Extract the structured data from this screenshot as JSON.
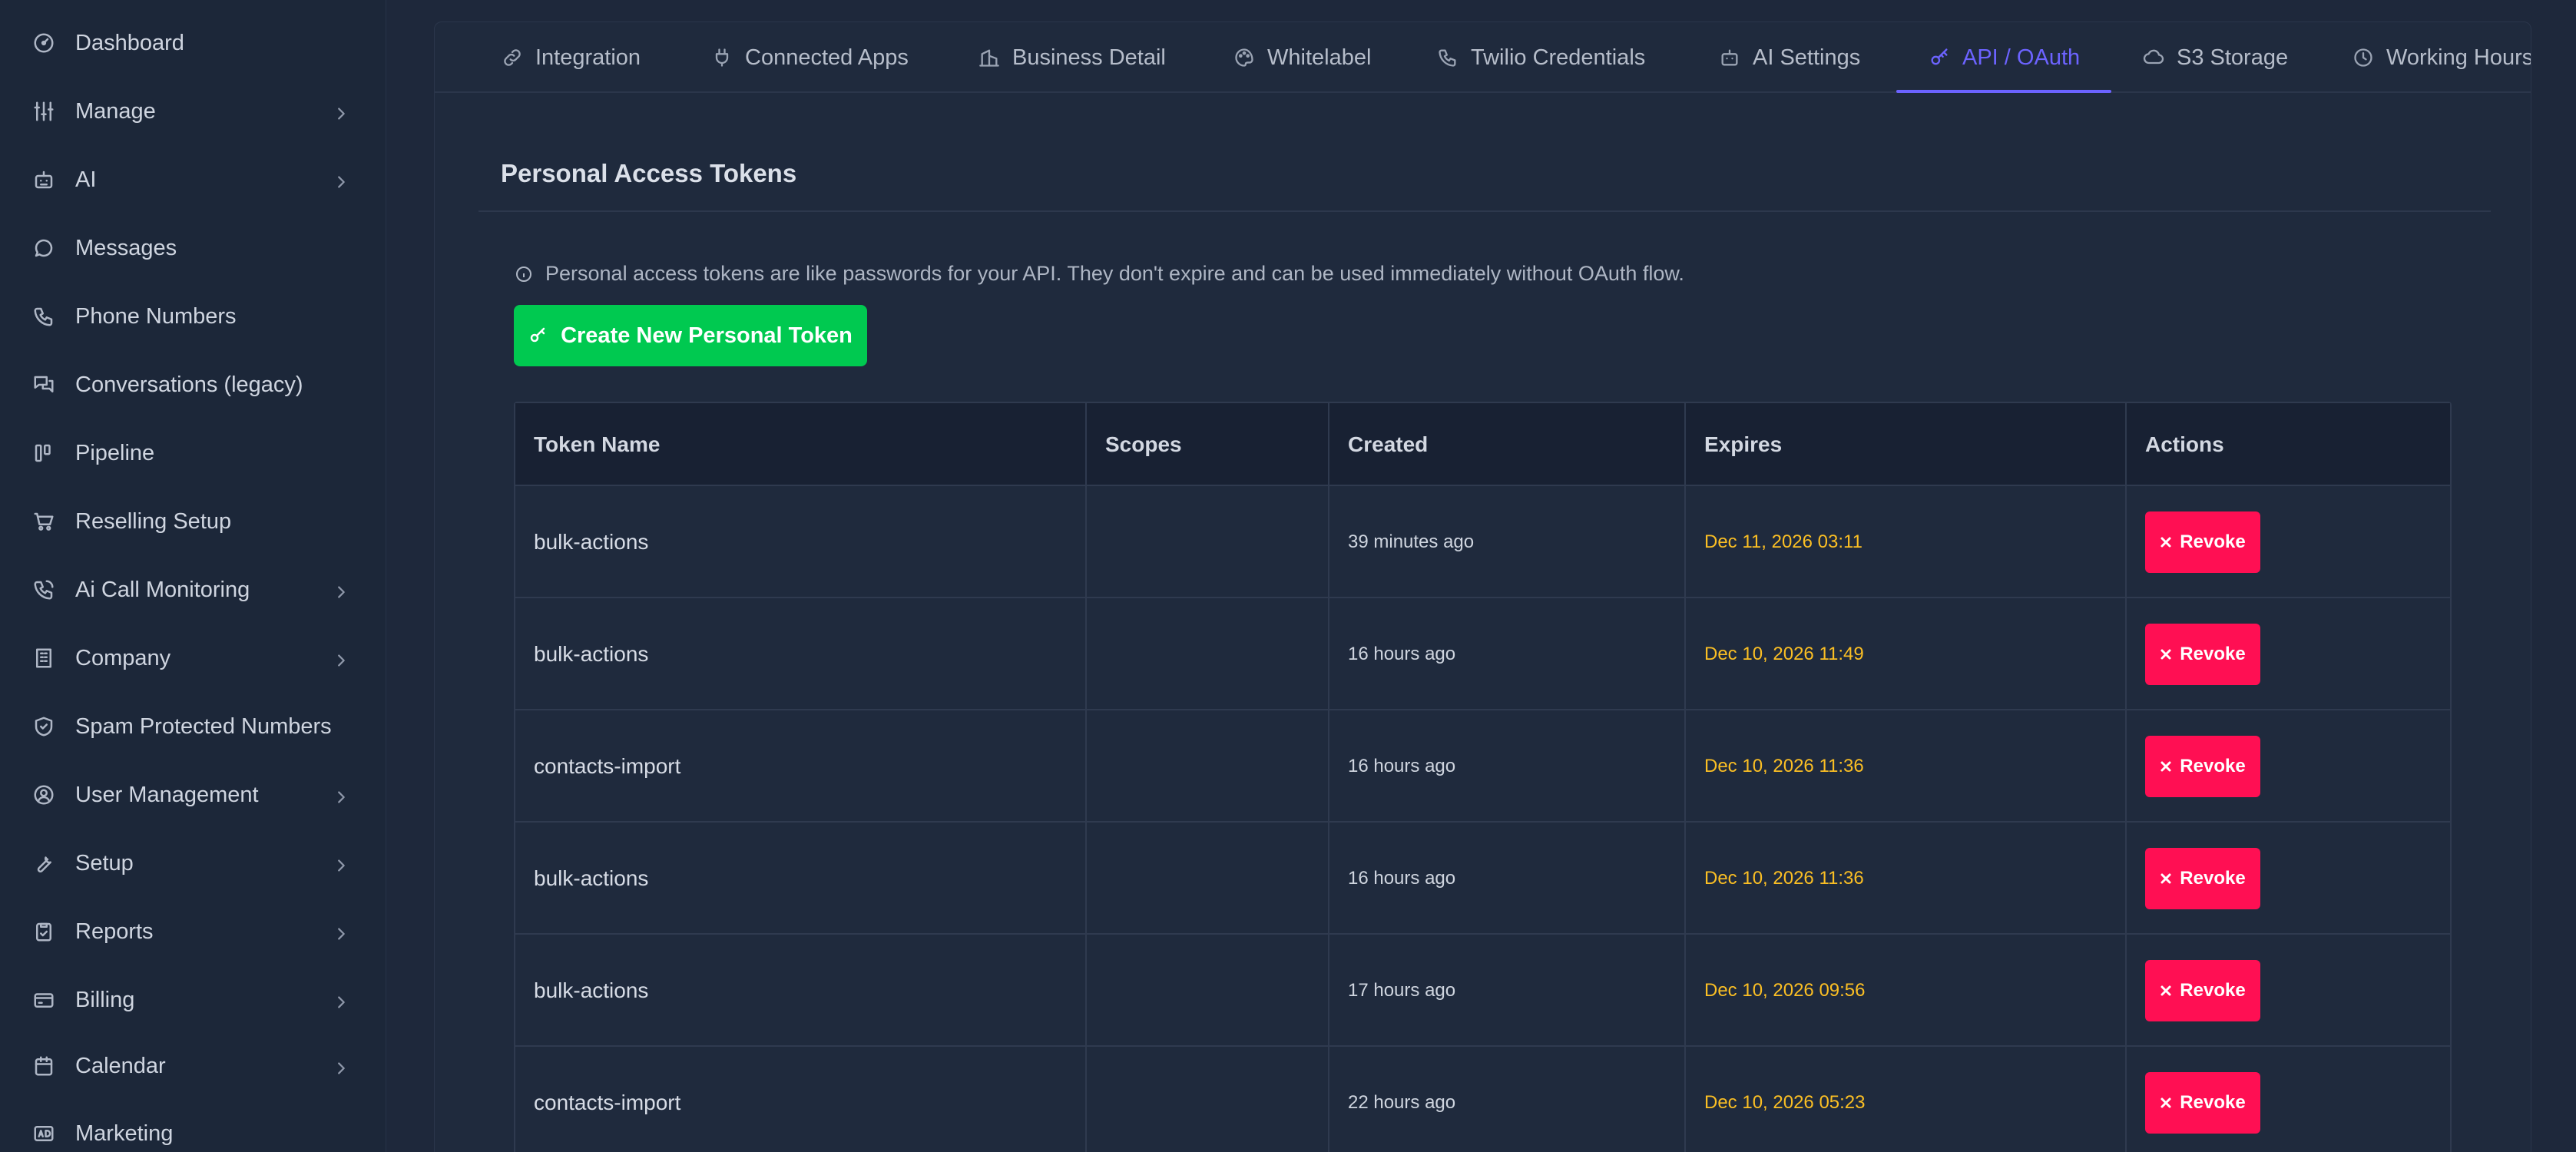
{
  "sidebar": {
    "items": [
      {
        "label": "Dashboard",
        "icon": "gauge-icon",
        "has_children": false
      },
      {
        "label": "Manage",
        "icon": "sliders-icon",
        "has_children": true
      },
      {
        "label": "AI",
        "icon": "robot-icon",
        "has_children": true
      },
      {
        "label": "Messages",
        "icon": "chat-icon",
        "has_children": false
      },
      {
        "label": "Phone Numbers",
        "icon": "phone-icon",
        "has_children": false
      },
      {
        "label": "Conversations (legacy)",
        "icon": "conversations-icon",
        "has_children": false
      },
      {
        "label": "Pipeline",
        "icon": "pipeline-icon",
        "has_children": false
      },
      {
        "label": "Reselling Setup",
        "icon": "cart-icon",
        "has_children": false
      },
      {
        "label": "Ai Call Monitoring",
        "icon": "phone-monitor-icon",
        "has_children": true
      },
      {
        "label": "Company",
        "icon": "building-icon",
        "has_children": true
      },
      {
        "label": "Spam Protected Numbers",
        "icon": "shield-icon",
        "has_children": false
      },
      {
        "label": "User Management",
        "icon": "user-circle-icon",
        "has_children": true
      },
      {
        "label": "Setup",
        "icon": "wrench-icon",
        "has_children": true
      },
      {
        "label": "Reports",
        "icon": "clipboard-icon",
        "has_children": true
      },
      {
        "label": "Billing",
        "icon": "credit-card-icon",
        "has_children": true
      },
      {
        "label": "Calendar",
        "icon": "calendar-icon",
        "has_children": true
      },
      {
        "label": "Marketing",
        "icon": "ad-icon",
        "has_children": false
      }
    ]
  },
  "tabs": [
    {
      "label": "Integration",
      "icon": "link-icon",
      "active": false
    },
    {
      "label": "Connected Apps",
      "icon": "plug-icon",
      "active": false
    },
    {
      "label": "Business Detail",
      "icon": "building-icon",
      "active": false
    },
    {
      "label": "Whitelabel",
      "icon": "palette-icon",
      "active": false
    },
    {
      "label": "Twilio Credentials",
      "icon": "phone-icon",
      "active": false
    },
    {
      "label": "AI Settings",
      "icon": "robot-icon",
      "active": false
    },
    {
      "label": "API / OAuth",
      "icon": "key-icon",
      "active": true
    },
    {
      "label": "S3 Storage",
      "icon": "cloud-icon",
      "active": false
    },
    {
      "label": "Working Hours",
      "icon": "clock-icon",
      "active": false
    }
  ],
  "section": {
    "title": "Personal Access Tokens",
    "info": "Personal access tokens are like passwords for your API. They don't expire and can be used immediately without OAuth flow.",
    "create_button": "Create New Personal Token"
  },
  "table": {
    "headers": [
      "Token Name",
      "Scopes",
      "Created",
      "Expires",
      "Actions"
    ],
    "rows": [
      {
        "name": "bulk-actions",
        "scopes": "",
        "created": "39 minutes ago",
        "expires": "Dec 11, 2026 03:11",
        "action": "Revoke"
      },
      {
        "name": "bulk-actions",
        "scopes": "",
        "created": "16 hours ago",
        "expires": "Dec 10, 2026 11:49",
        "action": "Revoke"
      },
      {
        "name": "contacts-import",
        "scopes": "",
        "created": "16 hours ago",
        "expires": "Dec 10, 2026 11:36",
        "action": "Revoke"
      },
      {
        "name": "bulk-actions",
        "scopes": "",
        "created": "16 hours ago",
        "expires": "Dec 10, 2026 11:36",
        "action": "Revoke"
      },
      {
        "name": "bulk-actions",
        "scopes": "",
        "created": "17 hours ago",
        "expires": "Dec 10, 2026 09:56",
        "action": "Revoke"
      },
      {
        "name": "contacts-import",
        "scopes": "",
        "created": "22 hours ago",
        "expires": "Dec 10, 2026 05:23",
        "action": "Revoke"
      }
    ]
  },
  "colors": {
    "accent": "#6c63ff",
    "create_button": "#00c950",
    "revoke_button": "#ff0f53",
    "expires_text": "#fbbf24"
  }
}
